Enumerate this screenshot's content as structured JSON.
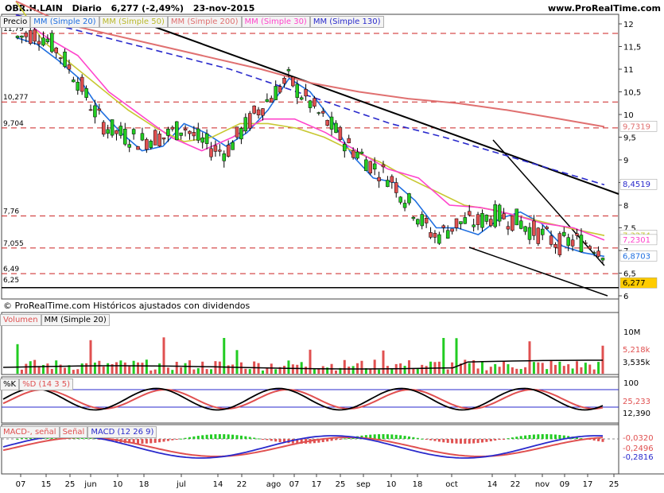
{
  "header": {
    "symbol": "OBR.H.LAIN",
    "period": "Diario",
    "last": "6,277 (-2,49%)",
    "date": "23-nov-2015",
    "site": "www.ProRealTime.com"
  },
  "copyright": "© ProRealTime.com Históricos ajustados con dividendos",
  "colors": {
    "up": "#22cc22",
    "down": "#e05050",
    "sma20": "#1f6fe0",
    "sma50": "#c8c832",
    "sma200": "#e07070",
    "sma30": "#ff44cc",
    "sma130": "#2a2acc",
    "volume_sma": "#000000"
  },
  "price_panel": {
    "legend": [
      "Precio",
      "MM (Simple 20)",
      "MM (Simple 50)",
      "MM (Simple 200)",
      "MM (Simple 30)",
      "MM (Simple 130)"
    ],
    "y_ticks": [
      "12",
      "11,5",
      "11",
      "10,5",
      "10",
      "9,5",
      "9",
      "8,5",
      "8",
      "7,5",
      "7",
      "6,5",
      "6"
    ],
    "left_levels": [
      "11,79",
      "10,277",
      "9,704",
      "7,76",
      "7,055",
      "6,49",
      "6,25"
    ],
    "right_labels": [
      "9,7319",
      "8,4519",
      "7,3274",
      "7,2301",
      "6,8703",
      "6,277"
    ]
  },
  "volume_panel": {
    "legend": [
      "Volumen",
      "MM (Simple 20)"
    ],
    "y_ticks": [
      "10M"
    ],
    "right_labels": [
      "5,218k",
      "3,535k"
    ]
  },
  "stoch_panel": {
    "legend": [
      "%K",
      "%D (14 3 5)"
    ],
    "y_ticks": [
      "100"
    ],
    "right_labels": [
      "25,233",
      "12,390"
    ]
  },
  "macd_panel": {
    "legend": [
      "MACD-, señal",
      "Señal",
      "MACD (12 26 9)"
    ],
    "right_labels": [
      "-0,0320",
      "-0,2496",
      "-0,2816"
    ]
  },
  "x_ticks": [
    "07",
    "15",
    "25",
    "jun",
    "10",
    "18",
    "jul",
    "14",
    "22",
    "ago",
    "07",
    "17",
    "25",
    "sep",
    "10",
    "18",
    "oct",
    "14",
    "22",
    "nov",
    "09",
    "17",
    "25"
  ],
  "chart_data": {
    "type": "candlestick",
    "title": "OBR.H.LAIN Diario 6,277 (-2,49%) 23-nov-2015",
    "xlabel": "",
    "ylabel": "",
    "ylim": [
      6,
      12.2
    ],
    "series": [
      {
        "name": "MM (Simple 20)",
        "values": [
          11.7,
          11.55,
          11.2,
          10.8,
          10.1,
          9.6,
          9.2,
          9.3,
          9.8,
          9.6,
          9.3,
          9.6,
          10.1,
          10.8,
          10.5,
          9.9,
          9.1,
          8.6,
          8.5,
          8.1,
          7.5,
          7.5,
          7.35,
          7.7,
          7.85,
          7.6,
          7.1,
          6.95,
          6.87
        ]
      },
      {
        "name": "MM (Simple 50)",
        "values": [
          12.5,
          11.6,
          11.1,
          10.6,
          10.1,
          9.7,
          9.4,
          9.5,
          9.8,
          9.8,
          9.7,
          9.5,
          9.2,
          8.95,
          8.6,
          8.3,
          8.0,
          7.9,
          7.75,
          7.6,
          7.46,
          7.33
        ]
      },
      {
        "name": "MM (Simple 200)",
        "values": [
          12.5,
          12.0,
          11.75,
          11.5,
          11.25,
          11.0,
          10.7,
          10.5,
          10.35,
          10.25,
          10.1,
          9.92,
          9.73
        ]
      },
      {
        "name": "MM (Simple 30)",
        "values": [
          12.2,
          11.7,
          11.3,
          10.5,
          10.0,
          9.5,
          9.2,
          9.5,
          9.9,
          9.9,
          9.6,
          9.2,
          8.8,
          8.6,
          8.0,
          7.95,
          7.8,
          7.6,
          7.5,
          7.23
        ]
      },
      {
        "name": "MM (Simple 130)",
        "values": [
          12.2,
          11.9,
          11.6,
          11.3,
          11.0,
          10.6,
          10.2,
          9.8,
          9.5,
          9.15,
          8.8,
          8.45
        ]
      }
    ]
  }
}
